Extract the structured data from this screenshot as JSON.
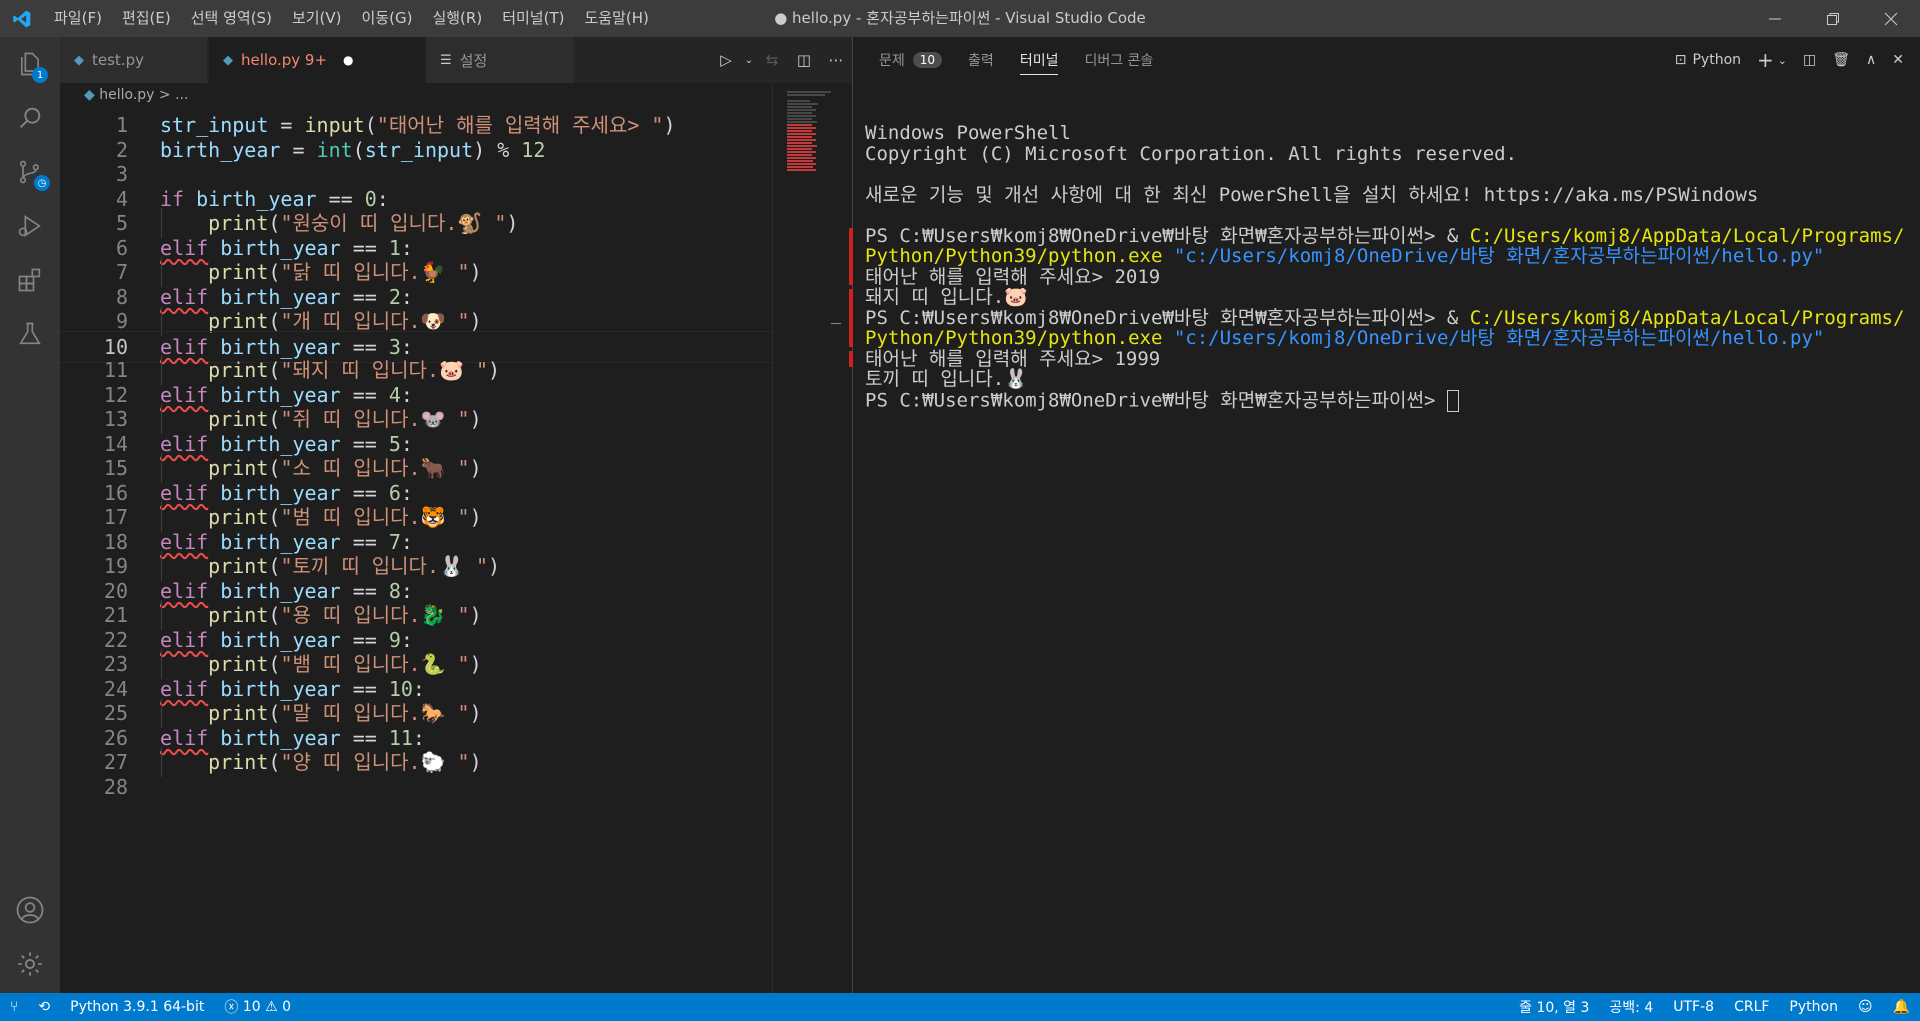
{
  "titlebar": {
    "menu": [
      "파일(F)",
      "편집(E)",
      "선택 영역(S)",
      "보기(V)",
      "이동(G)",
      "실행(R)",
      "터미널(T)",
      "도움말(H)"
    ],
    "title": "● hello.py - 혼자공부하는파이썬 - Visual Studio Code"
  },
  "activity": {
    "explorer_badge": "1"
  },
  "tabs": [
    {
      "label": "test.py",
      "modified": false
    },
    {
      "label": "hello.py 9+",
      "modified": true
    },
    {
      "label": "설정",
      "modified": false
    }
  ],
  "breadcrumb": {
    "file": "hello.py",
    "rest": "> ..."
  },
  "code": {
    "current_line": 10,
    "lines": [
      "str_input = input(\"태어난 해를 입력해 주세요> \")",
      "birth_year = int(str_input) % 12",
      "",
      "if birth_year == 0:",
      "    print(\"원숭이 띠 입니다.🐒 \")",
      "elif birth_year == 1:",
      "    print(\"닭 띠 입니다.🐓 \")",
      "elif birth_year == 2:",
      "    print(\"개 띠 입니다.🐶 \")",
      "elif birth_year == 3:",
      "    print(\"돼지 띠 입니다.🐷 \")",
      "elif birth_year == 4:",
      "    print(\"쥐 띠 입니다.🐭 \")",
      "elif birth_year == 5:",
      "    print(\"소 띠 입니다.🐂 \")",
      "elif birth_year == 6:",
      "    print(\"범 띠 입니다.🐯 \")",
      "elif birth_year == 7:",
      "    print(\"토끼 띠 입니다.🐰 \")",
      "elif birth_year == 8:",
      "    print(\"용 띠 입니다.🐉 \")",
      "elif birth_year == 9:",
      "    print(\"뱀 띠 입니다.🐍 \")",
      "elif birth_year == 10:",
      "    print(\"말 띠 입니다.🐎 \")",
      "elif birth_year == 11:",
      "    print(\"양 띠 입니다.🐑 \")",
      ""
    ]
  },
  "panel": {
    "tabs": [
      {
        "label": "문제",
        "badge": "10"
      },
      {
        "label": "출력"
      },
      {
        "label": "터미널",
        "active": true
      },
      {
        "label": "디버그 콘솔"
      }
    ],
    "terminal_profile": "Python",
    "terminal_lines": [
      {
        "t": "Windows PowerShell"
      },
      {
        "t": "Copyright (C) Microsoft Corporation. All rights reserved."
      },
      {
        "t": ""
      },
      {
        "t": "새로운 기능 및 개선 사항에 대 한 최신 PowerShell을 설치 하세요! https://aka.ms/PSWindows"
      },
      {
        "t": ""
      },
      {
        "prompt": "PS C:₩Users₩komj8₩OneDrive₩바탕 화면₩혼자공부하는파이썬> & ",
        "exe": "C:/Users/komj8/AppData/Local/Programs/Python/Python39/python.exe",
        "arg": " \"c:/Users/komj8/OneDrive/바탕 화면/혼자공부하는파이썬/hello.py\""
      },
      {
        "t": "태어난 해를 입력해 주세요> 2019"
      },
      {
        "t": "돼지 띠 입니다.🐷"
      },
      {
        "prompt": "PS C:₩Users₩komj8₩OneDrive₩바탕 화면₩혼자공부하는파이썬> & ",
        "exe": "C:/Users/komj8/AppData/Local/Programs/Python/Python39/python.exe",
        "arg": " \"c:/Users/komj8/OneDrive/바탕 화면/혼자공부하는파이썬/hello.py\""
      },
      {
        "t": "태어난 해를 입력해 주세요> 1999"
      },
      {
        "t": "토끼 띠 입니다.🐰"
      },
      {
        "t": "PS C:₩Users₩komj8₩OneDrive₩바탕 화면₩혼자공부하는파이썬> ",
        "cursor": true
      }
    ]
  },
  "status": {
    "interpreter": "Python 3.9.1 64-bit",
    "errors": "10",
    "warnings": "0",
    "position": "줄 10, 열 3",
    "spaces": "공백: 4",
    "encoding": "UTF-8",
    "eol": "CRLF",
    "language": "Python"
  },
  "colors": {
    "accent": "#007acc",
    "keyword": "#c586c0",
    "function": "#dcdcaa",
    "string": "#ce9178",
    "number": "#b5cea8"
  }
}
